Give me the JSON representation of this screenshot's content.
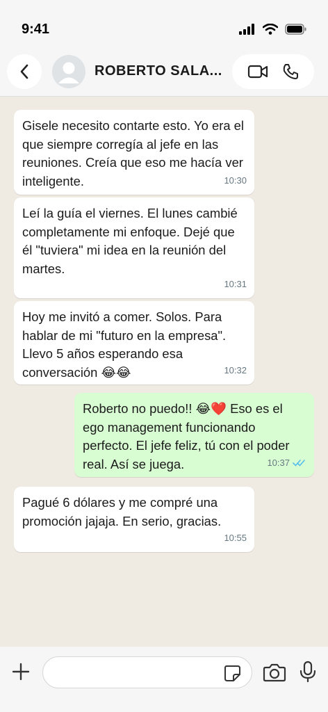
{
  "status_bar": {
    "time": "9:41"
  },
  "header": {
    "contact_name": "ROBERTO SALA..."
  },
  "messages": [
    {
      "direction": "in",
      "text": "Gisele necesito contarte esto. Yo era el que siempre corregía al jefe en las reuniones. Creía que eso me hacía ver inteligente.",
      "time": "10:30"
    },
    {
      "direction": "in",
      "text": "Leí la guía el viernes. El lunes cambié completamente mi enfoque. Dejé que él \"tuviera\" mi idea en la reunión del martes.",
      "time": "10:31"
    },
    {
      "direction": "in",
      "text": "Hoy me invitó a comer. Solos. Para hablar de mi \"futuro en la empresa\". Llevo 5 años esperando esa conversación 😂😂",
      "time": "10:32"
    },
    {
      "direction": "out",
      "text": "Roberto no puedo!! 😂❤️ Eso es el ego management funcionando perfecto. El jefe feliz, tú con el poder real. Así se juega.",
      "time": "10:37",
      "status": "read"
    },
    {
      "direction": "in",
      "text": "Pagué 6 dólares y me compré una promoción jajaja. En serio, gracias.",
      "time": "10:55"
    }
  ],
  "composer": {
    "placeholder": ""
  },
  "colors": {
    "chat_bg": "#efeae2",
    "incoming": "#ffffff",
    "outgoing": "#d9fdd3",
    "read_ticks": "#53bdeb"
  },
  "icons": [
    "back-chevron-icon",
    "avatar-placeholder-icon",
    "video-call-icon",
    "phone-icon",
    "plus-icon",
    "sticker-icon",
    "camera-icon",
    "mic-icon",
    "signal-icon",
    "wifi-icon",
    "battery-icon"
  ]
}
